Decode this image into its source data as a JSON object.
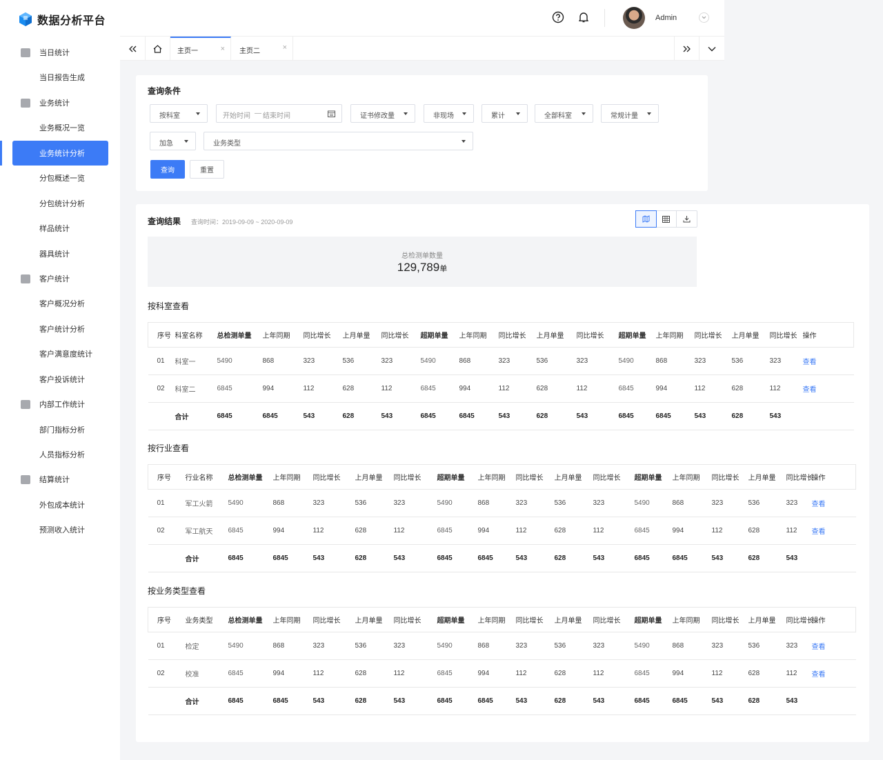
{
  "app": {
    "title": "数据分析平台"
  },
  "header": {
    "user_name": "Admin"
  },
  "sidebar": {
    "items": [
      {
        "label": "当日统计",
        "group": true
      },
      {
        "label": "当日报告生成"
      },
      {
        "label": "业务统计",
        "group": true
      },
      {
        "label": "业务概况一览"
      },
      {
        "label": "业务统计分析",
        "active": true
      },
      {
        "label": "分包概述一览"
      },
      {
        "label": "分包统计分析"
      },
      {
        "label": "样品统计"
      },
      {
        "label": "器具统计"
      },
      {
        "label": "客户统计",
        "group": true
      },
      {
        "label": "客户概况分析"
      },
      {
        "label": "客户统计分析"
      },
      {
        "label": "客户满意度统计"
      },
      {
        "label": "客户投诉统计"
      },
      {
        "label": "内部工作统计",
        "group": true
      },
      {
        "label": "部门指标分析"
      },
      {
        "label": "人员指标分析"
      },
      {
        "label": "结算统计",
        "group": true
      },
      {
        "label": "外包成本统计"
      },
      {
        "label": "预测收入统计"
      }
    ]
  },
  "tabs": [
    {
      "label": "主页一",
      "active": true
    },
    {
      "label": "主页二",
      "active": false
    }
  ],
  "query": {
    "title": "查询条件",
    "filters_row1": [
      "按科室",
      "证书修改量",
      "非现场",
      "累计",
      "全部科室",
      "常规计量"
    ],
    "date_start_placeholder": "开始时间",
    "date_sep": "—",
    "date_end_placeholder": "结束时间",
    "filter_urgent": "加急",
    "filter_biz_type": "业务类型",
    "btn_query": "查询",
    "btn_reset": "重置"
  },
  "results": {
    "title": "查询结果",
    "time_range": "查询时间：2019-09-09 ~ 2020-09-09",
    "summary_label": "总检测单数量",
    "summary_value": "129,789",
    "summary_unit": "单",
    "accent": "#3c7bf6"
  },
  "tables": [
    {
      "title": "按科室查看",
      "name_header": "科室名称",
      "rows": [
        {
          "idx": "01",
          "name": "科室一",
          "values": [
            "5490",
            "868",
            "323",
            "536",
            "323",
            "5490",
            "868",
            "323",
            "536",
            "323",
            "5490",
            "868",
            "323",
            "536",
            "323"
          ],
          "action": "查看"
        },
        {
          "idx": "02",
          "name": "科室二",
          "values": [
            "6845",
            "994",
            "112",
            "628",
            "112",
            "6845",
            "994",
            "112",
            "628",
            "112",
            "6845",
            "994",
            "112",
            "628",
            "112"
          ],
          "action": "查看"
        }
      ],
      "total": {
        "label": "合计",
        "values": [
          "6845",
          "6845",
          "543",
          "628",
          "543",
          "6845",
          "6845",
          "543",
          "628",
          "543",
          "6845",
          "6845",
          "543",
          "628",
          "543"
        ]
      }
    },
    {
      "title": "按行业查看",
      "name_header": "行业名称",
      "rows": [
        {
          "idx": "01",
          "name": "军工火箭",
          "values": [
            "5490",
            "868",
            "323",
            "536",
            "323",
            "5490",
            "868",
            "323",
            "536",
            "323",
            "5490",
            "868",
            "323",
            "536",
            "323"
          ],
          "action": "查看"
        },
        {
          "idx": "02",
          "name": "军工航天",
          "values": [
            "6845",
            "994",
            "112",
            "628",
            "112",
            "6845",
            "994",
            "112",
            "628",
            "112",
            "6845",
            "994",
            "112",
            "628",
            "112"
          ],
          "action": "查看"
        }
      ],
      "total": {
        "label": "合计",
        "values": [
          "6845",
          "6845",
          "543",
          "628",
          "543",
          "6845",
          "6845",
          "543",
          "628",
          "543",
          "6845",
          "6845",
          "543",
          "628",
          "543"
        ]
      }
    },
    {
      "title": "按业务类型查看",
      "name_header": "业务类型",
      "rows": [
        {
          "idx": "01",
          "name": "检定",
          "values": [
            "5490",
            "868",
            "323",
            "536",
            "323",
            "5490",
            "868",
            "323",
            "536",
            "323",
            "5490",
            "868",
            "323",
            "536",
            "323"
          ],
          "action": "查看"
        },
        {
          "idx": "02",
          "name": "校准",
          "values": [
            "6845",
            "994",
            "112",
            "628",
            "112",
            "6845",
            "994",
            "112",
            "628",
            "112",
            "6845",
            "994",
            "112",
            "628",
            "112"
          ],
          "action": "查看"
        }
      ],
      "total": {
        "label": "合计",
        "values": [
          "6845",
          "6845",
          "543",
          "628",
          "543",
          "6845",
          "6845",
          "543",
          "628",
          "543",
          "6845",
          "6845",
          "543",
          "628",
          "543"
        ]
      }
    }
  ],
  "table_headers": {
    "idx": "序号",
    "metrics": [
      "总检测单量",
      "上年同期",
      "同比增长",
      "上月单量",
      "同比增长",
      "超期单量",
      "上年同期",
      "同比增长",
      "上月单量",
      "同比增长",
      "超期单量",
      "上年同期",
      "同比增长",
      "上月单量",
      "同比增长"
    ],
    "bold_metric_indexes": [
      0,
      5,
      10
    ],
    "action": "操作"
  }
}
